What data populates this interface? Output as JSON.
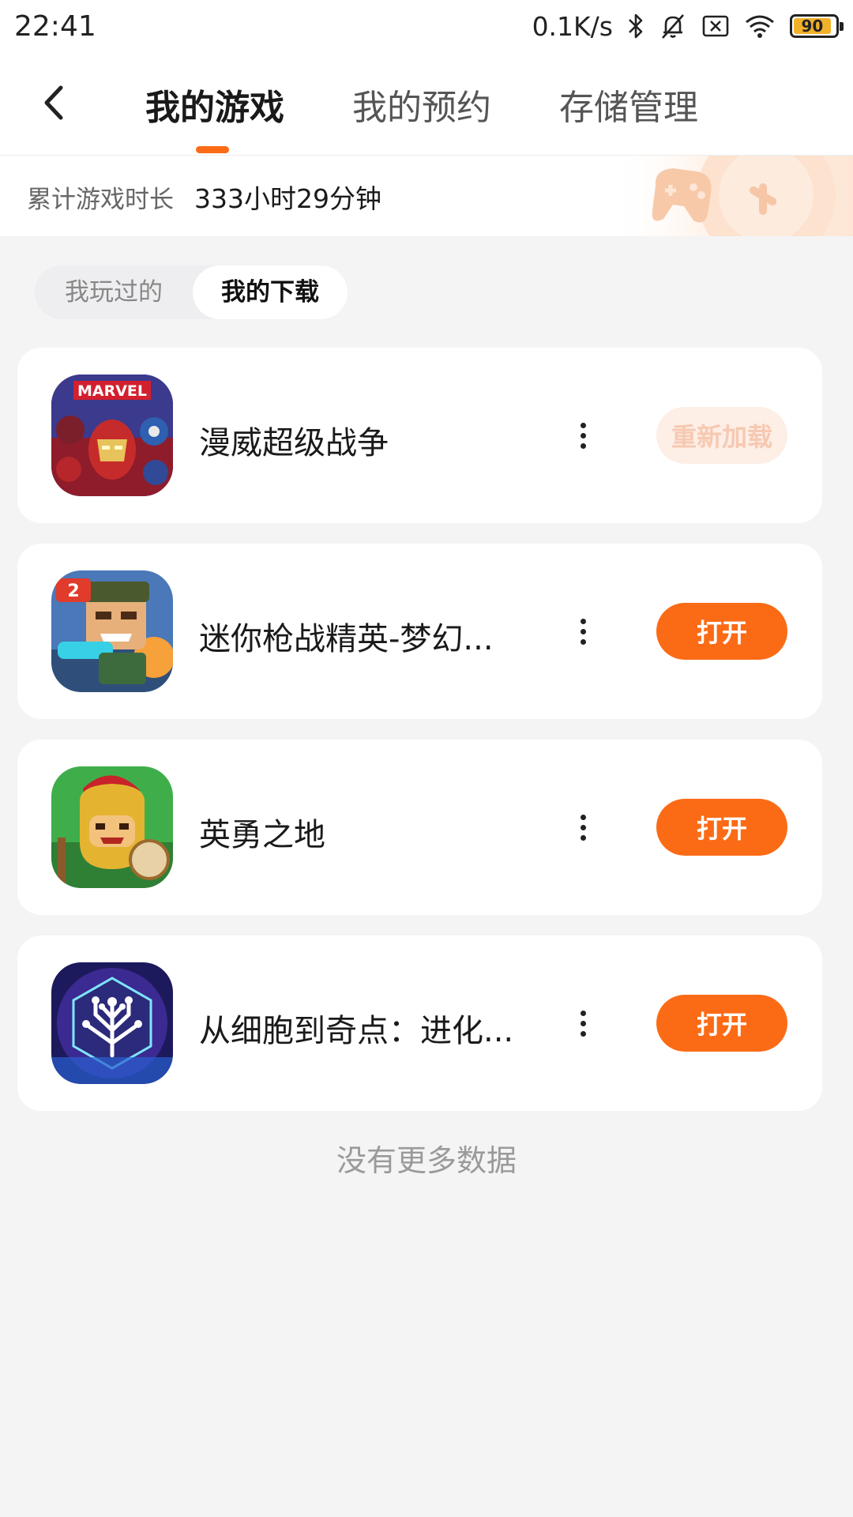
{
  "status_bar": {
    "time": "22:41",
    "net_speed": "0.1K/s",
    "battery_level": "90",
    "battery_fraction": 0.9,
    "icons": [
      "bluetooth-icon",
      "mute-bell-icon",
      "no-sim-icon",
      "wifi-icon",
      "battery-icon"
    ]
  },
  "header": {
    "tabs": [
      {
        "label": "我的游戏",
        "active": true
      },
      {
        "label": "我的预约",
        "active": false
      },
      {
        "label": "存储管理",
        "active": false
      }
    ],
    "accent_color": "#fb6b16"
  },
  "playtime": {
    "label": "累计游戏时长",
    "value": "333小时29分钟"
  },
  "segments": {
    "played": "我玩过的",
    "downloads": "我的下载",
    "selected": "downloads"
  },
  "games": [
    {
      "name": "漫威超级战争",
      "action": "重新加载",
      "action_state": "disabled"
    },
    {
      "name": "迷你枪战精英-梦幻...",
      "action": "打开",
      "action_state": "enabled"
    },
    {
      "name": "英勇之地",
      "action": "打开",
      "action_state": "enabled"
    },
    {
      "name": "从细胞到奇点：进化...",
      "action": "打开",
      "action_state": "enabled"
    }
  ],
  "footer": {
    "no_more": "没有更多数据"
  }
}
